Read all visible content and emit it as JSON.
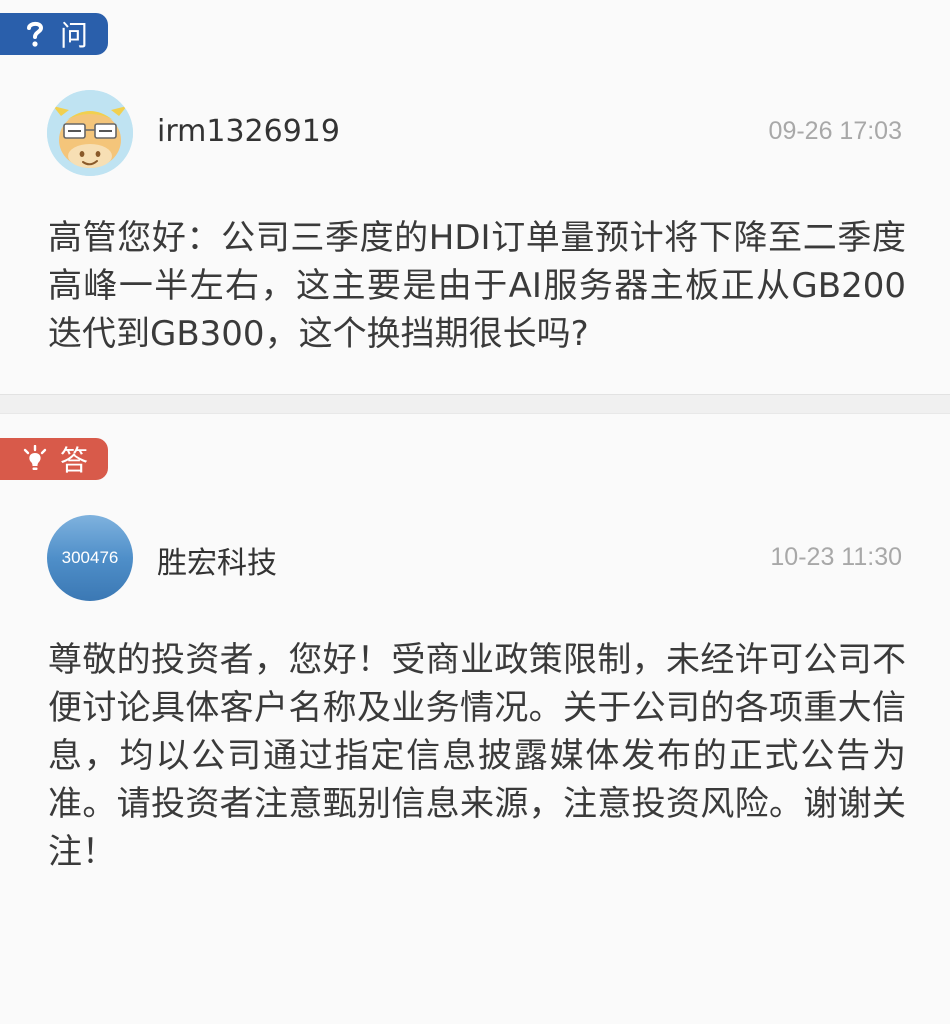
{
  "question": {
    "tag_icon": "question-mark-icon",
    "tag_label": "问",
    "tag_color": "#2a5fab",
    "username": "irm1326919",
    "timestamp": "09-26 17:03",
    "text": "高管您好：公司三季度的HDI订单量预计将下降至二季度高峰一半左右，这主要是由于AI服务器主板正从GB200迭代到GB300，这个换挡期很长吗?"
  },
  "answer": {
    "tag_icon": "lightbulb-icon",
    "tag_label": "答",
    "tag_color": "#d85a4a",
    "avatar_code": "300476",
    "username": "胜宏科技",
    "timestamp": "10-23 11:30",
    "text": "尊敬的投资者，您好！受商业政策限制，未经许可公司不便讨论具体客户名称及业务情况。关于公司的各项重大信息，均以公司通过指定信息披露媒体发布的正式公告为准。请投资者注意甄别信息来源，注意投资风险。谢谢关注！"
  }
}
